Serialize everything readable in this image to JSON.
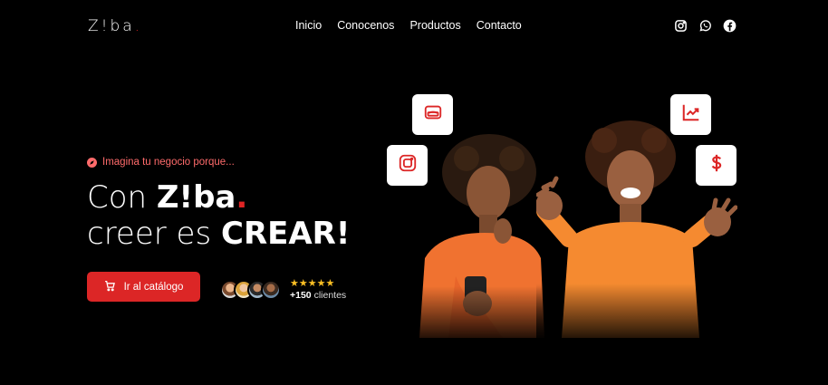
{
  "brand": {
    "logo_text": "Z!ba",
    "logo_dot": ".",
    "accent_color": "#e02424"
  },
  "nav": {
    "items": [
      "Inicio",
      "Conocenos",
      "Productos",
      "Contacto"
    ]
  },
  "social": {
    "icons": [
      "instagram-icon",
      "whatsapp-icon",
      "facebook-icon"
    ]
  },
  "hero": {
    "eyebrow": "Imagina tu negocio porque...",
    "line1_prefix": "Con ",
    "line1_brand": "Z!ba",
    "line1_dot": ".",
    "line2_prefix": "creer es ",
    "line2_emphasis": "CREAR!",
    "cta_label": "Ir al catálogo",
    "stars": "★★★★★",
    "clients_count": "+150",
    "clients_label": " clientes"
  },
  "illustration": {
    "cards": [
      "wallet-icon",
      "instagram-icon",
      "chart-up-icon",
      "dollar-icon"
    ]
  }
}
